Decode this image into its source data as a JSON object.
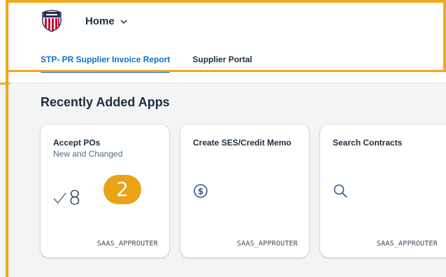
{
  "header": {
    "home_label": "Home",
    "tabs": [
      {
        "label": "STP- PR Supplier Invoice Report",
        "active": true
      },
      {
        "label": "Supplier Portal",
        "active": false
      }
    ]
  },
  "section": {
    "title": "Recently Added Apps"
  },
  "tiles": [
    {
      "title": "Accept POs",
      "subtitle": "New and Changed",
      "kpi_icon": "checkmark-icon",
      "kpi_value": "8",
      "footer": "SAAS_APPROUTER"
    },
    {
      "title": "Create SES/Credit Memo",
      "subtitle": "",
      "icon": "dollar-circle-icon",
      "footer": "SAAS_APPROUTER"
    },
    {
      "title": "Search Contracts",
      "subtitle": "",
      "icon": "search-icon",
      "footer": "SAAS_APPROUTER"
    }
  ],
  "annotation": {
    "step_number": "2",
    "color": "#e8a317"
  },
  "colors": {
    "accent": "#0a6ed1",
    "highlight_outline": "#f0a81e",
    "background": "#f3f4f6"
  }
}
